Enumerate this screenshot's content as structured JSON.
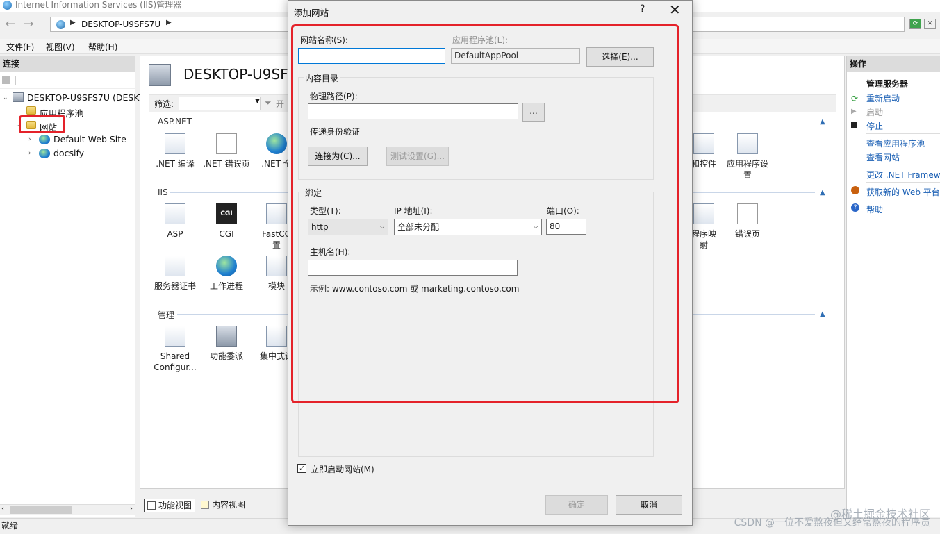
{
  "window": {
    "title": "Internet Information Services (IIS)管理器",
    "address_crumb": "DESKTOP-U9SFS7U"
  },
  "menu": [
    "文件(F)",
    "视图(V)",
    "帮助(H)"
  ],
  "connections": {
    "header": "连接",
    "tree": {
      "server": "DESKTOP-U9SFS7U (DESKT",
      "app_pools": "应用程序池",
      "sites": "网站",
      "site_1": "Default Web Site",
      "site_2": "docsify"
    }
  },
  "center": {
    "title": "DESKTOP-U9SFS",
    "filter_label": "筛选:",
    "filter_go": "开",
    "groups": {
      "aspnet": "ASP.NET",
      "iis": "IIS",
      "management": "管理"
    },
    "features": {
      "net_compile": ".NET 编译",
      "net_error": ".NET 错误页",
      "net_global": ".NET 全",
      "asp": "ASP",
      "cgi": "CGI",
      "fastcgi": "FastCG",
      "fastcgi_2": "置",
      "server_cert": "服务器证书",
      "worker": "工作进程",
      "modules": "模块",
      "shared_config": "Shared",
      "shared_config_2": "Configur...",
      "delegation": "功能委派",
      "central": "集中式证",
      "controls": "和控件",
      "app_settings": "应用程序设",
      "app_settings_2": "置",
      "handler_map": "程序映",
      "handler_map_2": "射",
      "error_pages": "错误页"
    },
    "view_tabs": {
      "features": "功能视图",
      "content": "内容视图"
    }
  },
  "actions": {
    "header": "操作",
    "section": "管理服务器",
    "items": {
      "restart": "重新启动",
      "start": "启动",
      "stop": "停止",
      "view_pools": "查看应用程序池",
      "view_sites": "查看网站",
      "change_net": "更改 .NET Framew",
      "get_web": "获取新的 Web 平台",
      "help": "帮助"
    }
  },
  "status": "就绪",
  "watermark": {
    "line1": "@稀土掘金技术社区",
    "line2": "CSDN @一位不爱熬夜但又经常熬夜的程序员"
  },
  "dialog": {
    "title": "添加网站",
    "help": "?",
    "close": "✕",
    "site_name_label": "网站名称(S):",
    "site_name_value": "",
    "app_pool_label": "应用程序池(L):",
    "app_pool_value": "DefaultAppPool",
    "select_button": "选择(E)...",
    "content_dir_label": "内容目录",
    "physical_path_label": "物理路径(P):",
    "physical_path_value": "",
    "browse_button": "...",
    "pass_through_label": "传递身份验证",
    "connect_as_button": "连接为(C)...",
    "test_settings_button": "测试设置(G)...",
    "binding_label": "绑定",
    "type_label": "类型(T):",
    "type_value": "http",
    "ip_label": "IP 地址(I):",
    "ip_value": "全部未分配",
    "port_label": "端口(O):",
    "port_value": "80",
    "host_label": "主机名(H):",
    "host_value": "",
    "example": "示例: www.contoso.com 或 marketing.contoso.com",
    "start_now_label": "立即启动网站(M)",
    "start_now_checked": "✓",
    "ok_button": "确定",
    "cancel_button": "取消"
  },
  "colors": {
    "highlight_red": "#e4222a",
    "link_blue": "#1a5fb4"
  }
}
